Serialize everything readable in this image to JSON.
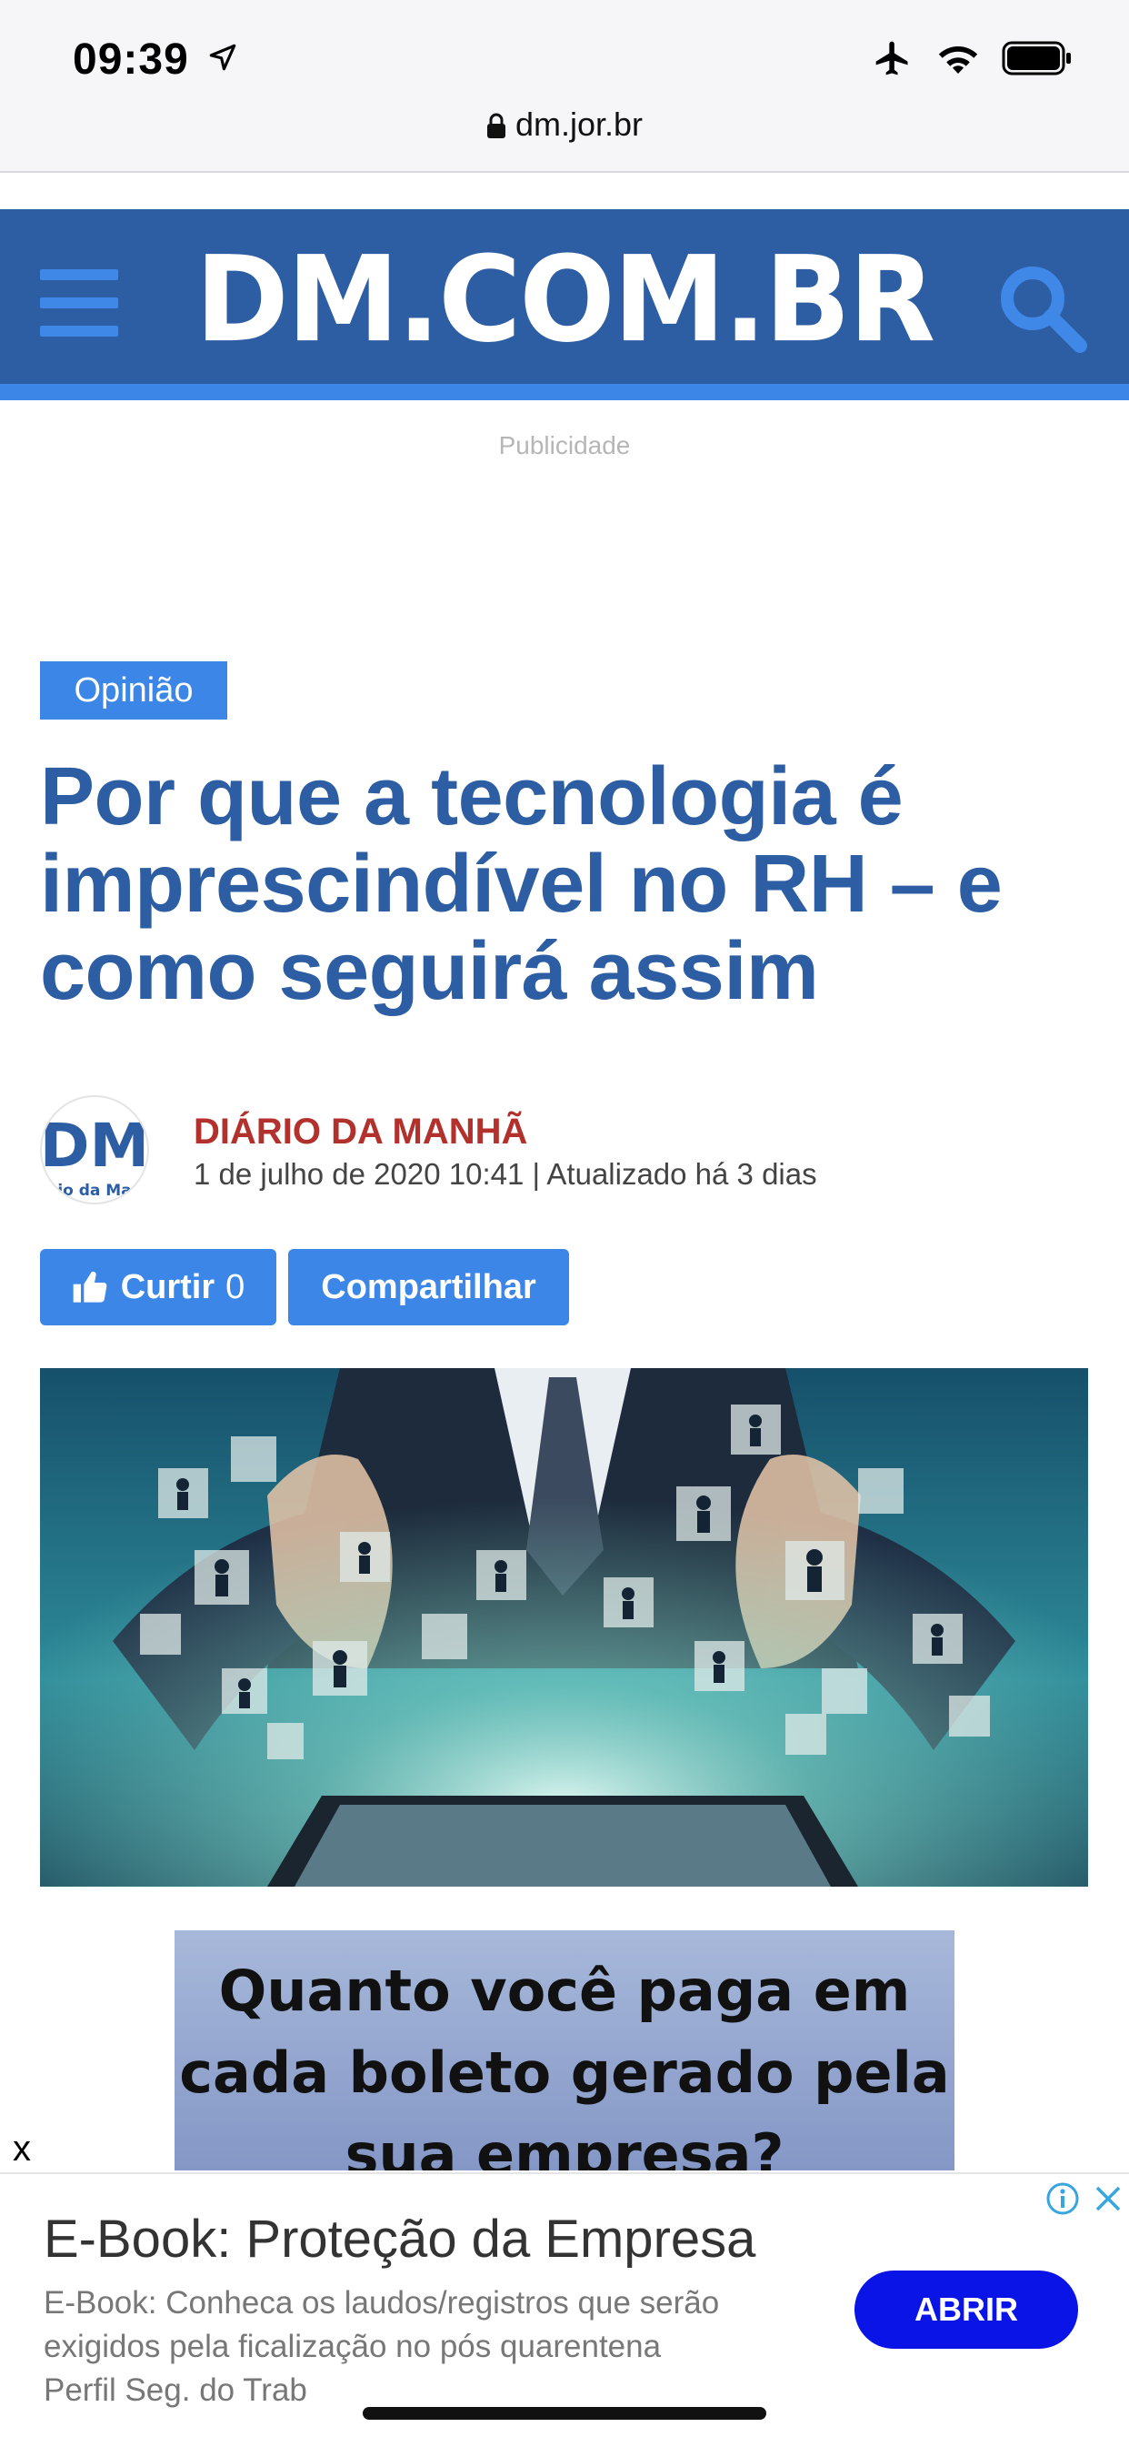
{
  "status_bar": {
    "time": "09:39",
    "url": "dm.jor.br"
  },
  "header": {
    "logo": "DM.COM.BR",
    "menu_icon": "hamburger-menu-icon",
    "search_icon": "search-icon"
  },
  "ad_label": "Publicidade",
  "article": {
    "category": "Opinião",
    "title": "Por que a tecnologia é imprescindível no RH – e como seguirá assim",
    "author": {
      "name": "DIÁRIO DA MANHÃ",
      "avatar_text": "DM",
      "avatar_subtext": "io da Ma",
      "date": "1 de julho de 2020 10:41 | Atualizado há 3 dias"
    },
    "actions": {
      "like_label": "Curtir",
      "like_count": "0",
      "share_label": "Compartilhar"
    }
  },
  "inline_ad": {
    "line1": "Quanto você paga em",
    "line2": "cada boleto gerado pela",
    "line3": "sua empresa?"
  },
  "bottom_ad": {
    "close_label": "x",
    "title": "E-Book: Proteção da Empresa",
    "description": "E-Book: Conheca os laudos/registros que serão exigidos pela ficalização no pós quarentena",
    "advertiser": "Perfil Seg. do Trab",
    "cta": "ABRIR"
  },
  "colors": {
    "brand_blue": "#2d5ea3",
    "accent_blue": "#3b86e6",
    "author_red": "#b3312c",
    "cta_blue": "#0a14e6"
  }
}
